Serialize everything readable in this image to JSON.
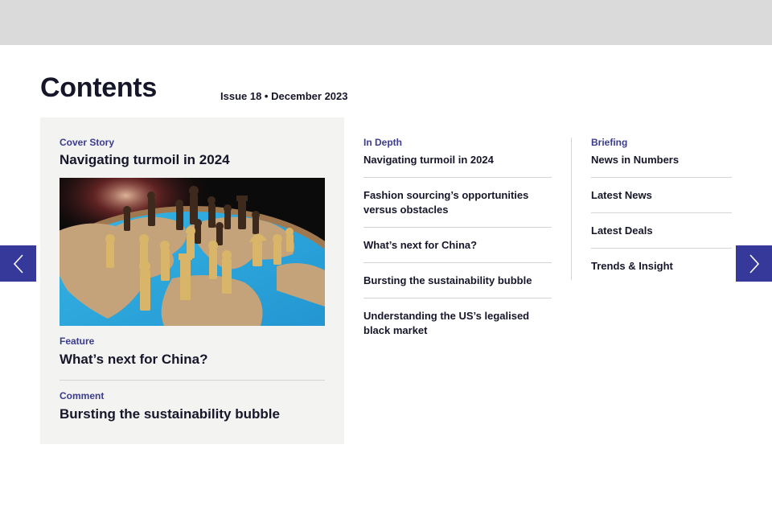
{
  "header": {
    "title": "Contents",
    "issue": "Issue 18 • December 2023"
  },
  "feature": {
    "cover": {
      "category": "Cover Story",
      "title": "Navigating turmoil in 2024"
    },
    "items": [
      {
        "category": "Feature",
        "title": "What’s next for China?"
      },
      {
        "category": "Comment",
        "title": "Bursting the sustainability bubble"
      }
    ]
  },
  "in_depth": {
    "heading": "In Depth",
    "items": [
      "Navigating turmoil in 2024",
      "Fashion sourcing’s opportunities versus obstacles",
      "What’s next for China?",
      "Bursting the sustainability bubble",
      "Understanding the US’s legalised black market"
    ]
  },
  "briefing": {
    "heading": "Briefing",
    "items": [
      "News in Numbers",
      "Latest News",
      "Latest Deals",
      "Trends & Insight"
    ]
  },
  "colors": {
    "accent": "#37399a",
    "category": "#3b3b8f",
    "panel": "#f3f3f2",
    "topbar": "#dadada"
  },
  "icons": {
    "prev": "chevron-left-icon",
    "next": "chevron-right-icon"
  }
}
